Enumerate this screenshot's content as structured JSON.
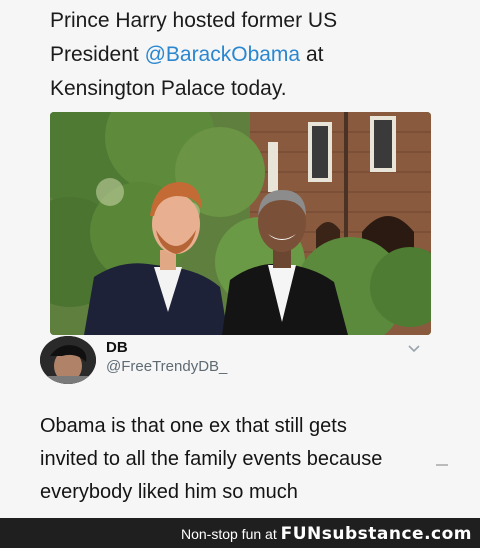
{
  "headline": {
    "line1": "Prince Harry hosted former US",
    "line2_before": "President ",
    "line2_mention": "@BarackObama",
    "line2_after": " at",
    "line3": "Kensington Palace today."
  },
  "author": {
    "name": "DB",
    "handle": "@FreeTrendyDB_"
  },
  "tweet": {
    "line1": "Obama is that one ex that still gets",
    "line2": "invited to all the family events because",
    "line3": "everybody liked him so much"
  },
  "footer": {
    "prefix": "Non-stop fun at",
    "brand": "FUNsubstance.com"
  },
  "colors": {
    "mention": "#2a87d0",
    "footer_bg": "#1f1f1f"
  }
}
